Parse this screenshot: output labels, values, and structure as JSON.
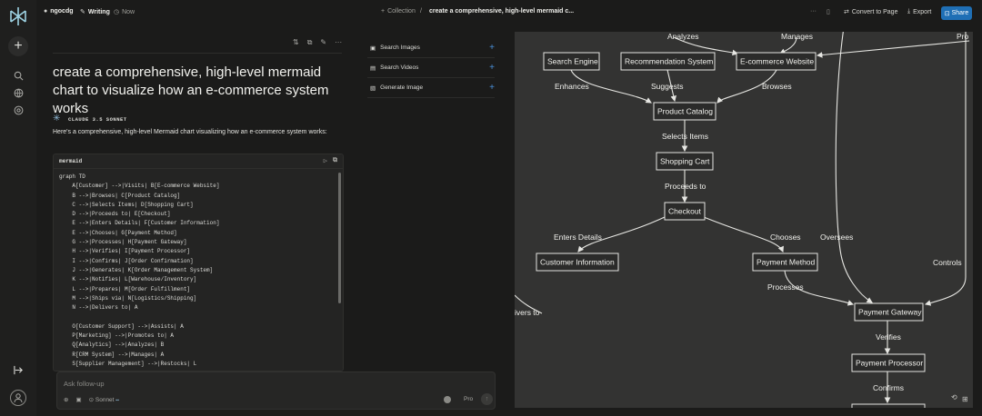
{
  "topbar": {
    "username": "ngocdg",
    "mode": "Writing",
    "time": "Now",
    "collection": "Collection",
    "separator": "/",
    "doc_title": "create a comprehensive, high-level mermaid c...",
    "more": "···",
    "convert": "Convert to Page",
    "export": "Export",
    "share": "Share"
  },
  "question": "create a comprehensive, high-level mermaid chart to visualize how an e-commerce system works",
  "model_name": "CLAUDE 3.5 SONNET",
  "answer_intro": "Here's a comprehensive, high-level Mermaid chart visualizing how an e-commerce system works:",
  "code": {
    "lang": "mermaid",
    "lines": [
      "graph TD",
      "    A[Customer] -->|Visits| B[E-commerce Website]",
      "    B -->|Browses| C[Product Catalog]",
      "    C -->|Selects Items| D[Shopping Cart]",
      "    D -->|Proceeds to| E[Checkout]",
      "    E -->|Enters Details| F[Customer Information]",
      "    E -->|Chooses| G[Payment Method]",
      "    G -->|Processes| H[Payment Gateway]",
      "    H -->|Verifies| I[Payment Processor]",
      "    I -->|Confirms| J[Order Confirmation]",
      "    J -->|Generates| K[Order Management System]",
      "    K -->|Notifies| L[Warehouse/Inventory]",
      "    L -->|Prepares| M[Order Fulfillment]",
      "    M -->|Ships via| N[Logistics/Shipping]",
      "    N -->|Delivers to| A",
      "",
      "    O[Customer Support] -->|Assists| A",
      "    P[Marketing] -->|Promotes to| A",
      "    Q[Analytics] -->|Analyzes| B",
      "    R[CRM System] -->|Manages| A",
      "    S[Supplier Management] -->|Restocks| L"
    ]
  },
  "followup": {
    "placeholder": "Ask follow-up",
    "model": "Sonnet",
    "pro": "Pro"
  },
  "actions": [
    {
      "label": "Search Images"
    },
    {
      "label": "Search Videos"
    },
    {
      "label": "Generate Image"
    }
  ],
  "diagram": {
    "nodes": {
      "search_engine": "Search Engine",
      "recommendation": "Recommendation System",
      "website": "E-commerce Website",
      "catalog": "Product Catalog",
      "cart": "Shopping Cart",
      "checkout": "Checkout",
      "customer_info": "Customer Information",
      "payment_method": "Payment Method",
      "payment_gateway": "Payment Gateway",
      "payment_processor": "Payment Processor"
    },
    "edge_labels": {
      "analyzes": "Analyzes",
      "manages": "Manages",
      "pro_cut": "Pro",
      "enhances": "Enhances",
      "suggests": "Suggests",
      "browses": "Browses",
      "selects_items": "Selects Items",
      "proceeds_to": "Proceeds to",
      "enters_details": "Enters Details",
      "chooses": "Chooses",
      "oversees": "Oversees",
      "controls": "Controls",
      "processes": "Processes",
      "delivers_cut": "ivers to",
      "verifies": "Verifies",
      "confirms": "Confirms"
    }
  }
}
